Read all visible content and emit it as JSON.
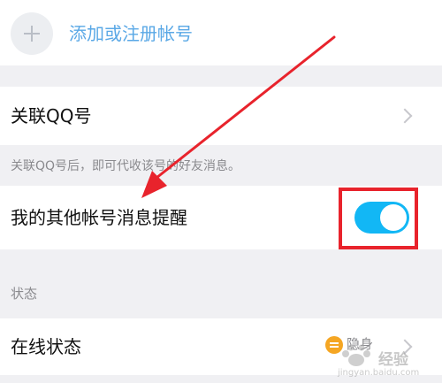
{
  "account": {
    "add_label": "添加或注册帐号"
  },
  "qq_link": {
    "label": "关联QQ号",
    "hint": "关联QQ号后，即可代收该号的好友消息。"
  },
  "remind": {
    "label": "我的其他帐号消息提醒",
    "toggle_on": true
  },
  "status_section": {
    "title": "状态",
    "row_label": "在线状态",
    "value": "隐身"
  },
  "watermark": {
    "text": "经验",
    "url": "jingyan.baidu.com"
  },
  "colors": {
    "accent_blue": "#5aa8e6",
    "toggle_on": "#12b7f5",
    "annotation_red": "#e8232c",
    "status_orange": "#f5a623"
  }
}
